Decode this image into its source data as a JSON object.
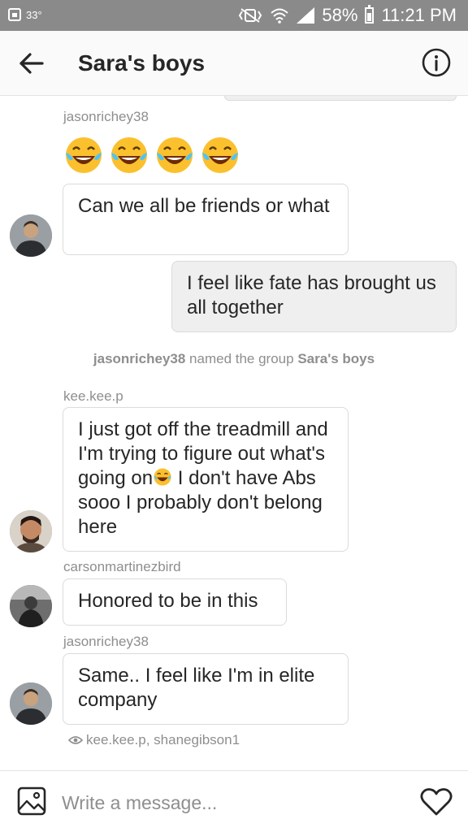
{
  "status_bar": {
    "temperature": "33°",
    "battery_percent": "58%",
    "time": "11:21 PM"
  },
  "header": {
    "title": "Sara's boys",
    "back_icon": "arrow-left-icon",
    "info_icon": "info-icon"
  },
  "messages": [
    {
      "sender": "jasonrichey38",
      "emoji_count": 4,
      "emoji": "face-with-tears-of-joy"
    },
    {
      "sender": "jasonrichey38",
      "text": "Can we all be friends or what"
    },
    {
      "sender": "me",
      "text": "I feel like fate has brought us all together"
    },
    {
      "sender": "kee.kee.p",
      "text_before_emoji": "I just got off the treadmill and I'm trying to figure out what's going on",
      "text_after_emoji": " I don't have Abs sooo I probably don't belong here"
    },
    {
      "sender": "carsonmartinezbird",
      "text": "Honored to be in this"
    },
    {
      "sender": "jasonrichey38",
      "text": "Same.. I feel like I'm in elite company"
    }
  ],
  "system_message": {
    "actor": "jasonrichey38",
    "action": "named the group",
    "group_name": "Sara's boys"
  },
  "seen_by": "kee.kee.p, shanegibson1",
  "composer": {
    "placeholder": "Write a message...",
    "gallery_icon": "image-icon",
    "like_icon": "heart-icon"
  },
  "colors": {
    "status_bar": "#8a8a8a",
    "bubble_mine": "#efefef",
    "bubble_border": "#dbdbdb",
    "meta_text": "#8e8e8e"
  }
}
